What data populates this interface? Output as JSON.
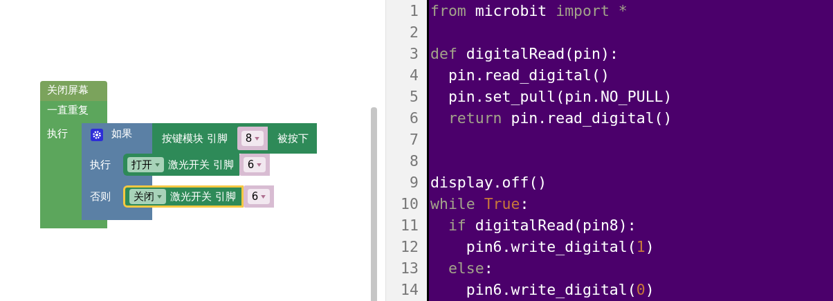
{
  "workspace": {
    "top_block": {
      "label": "关闭屏幕"
    },
    "loop": {
      "label": "一直重复",
      "do_label": "执行"
    },
    "if_block": {
      "if_label": "如果",
      "do_label": "执行",
      "else_label": "否则",
      "condition": {
        "label": "按键模块 引脚",
        "pin": "8",
        "suffix": "被按下"
      },
      "statements": [
        {
          "state": "打开",
          "label": "激光开关 引脚",
          "pin": "6",
          "selected": false
        },
        {
          "state": "关闭",
          "label": "激光开关 引脚",
          "pin": "6",
          "selected": true
        }
      ]
    }
  },
  "editor": {
    "lines": [
      {
        "number": "1",
        "tokens": [
          {
            "kind": "keyword",
            "text": "from"
          },
          {
            "kind": "plain",
            "text": " microbit "
          },
          {
            "kind": "keyword",
            "text": "import *"
          }
        ]
      },
      {
        "number": "2"
      },
      {
        "number": "3",
        "tokens": [
          {
            "kind": "keyword",
            "text": "def"
          },
          {
            "kind": "plain",
            "text": " digitalRead(pin):"
          }
        ]
      },
      {
        "number": "4",
        "tokens": [
          {
            "kind": "plain",
            "text": "  pin.read_digital()"
          }
        ]
      },
      {
        "number": "5",
        "tokens": [
          {
            "kind": "plain",
            "text": "  pin.set_pull(pin.NO_PULL)"
          }
        ]
      },
      {
        "number": "6",
        "tokens": [
          {
            "kind": "keyword",
            "text": "  return"
          },
          {
            "kind": "plain",
            "text": " pin.read_digital()"
          }
        ]
      },
      {
        "number": "7"
      },
      {
        "number": "8"
      },
      {
        "number": "9",
        "tokens": [
          {
            "kind": "plain",
            "text": "display.off()"
          }
        ]
      },
      {
        "number": "10",
        "tokens": [
          {
            "kind": "keyword",
            "text": "while"
          },
          {
            "kind": "constant",
            "text": " True"
          },
          {
            "kind": "plain",
            "text": ":"
          }
        ]
      },
      {
        "number": "11",
        "tokens": [
          {
            "kind": "keyword",
            "text": "  if"
          },
          {
            "kind": "plain",
            "text": " digitalRead(pin8):"
          }
        ]
      },
      {
        "number": "12",
        "tokens": [
          {
            "kind": "plain",
            "text": "    pin6.write_digital("
          },
          {
            "kind": "number",
            "text": "1"
          },
          {
            "kind": "plain",
            "text": ")"
          }
        ]
      },
      {
        "number": "13",
        "tokens": [
          {
            "kind": "keyword",
            "text": "  else"
          },
          {
            "kind": "plain",
            "text": ":"
          }
        ]
      },
      {
        "number": "14",
        "tokens": [
          {
            "kind": "plain",
            "text": "    pin6.write_digital("
          },
          {
            "kind": "number",
            "text": "0"
          },
          {
            "kind": "plain",
            "text": ")"
          }
        ]
      }
    ]
  }
}
